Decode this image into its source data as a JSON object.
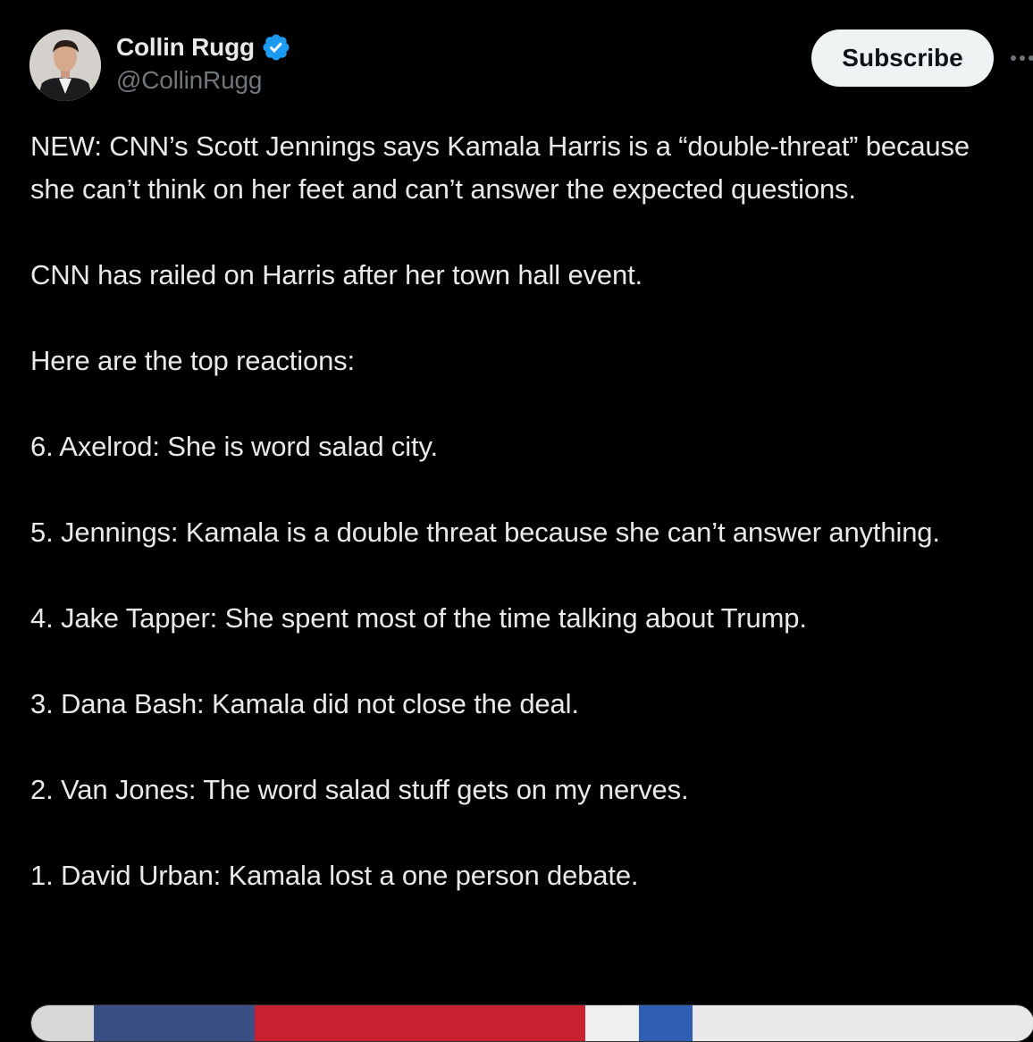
{
  "author": {
    "display_name": "Collin Rugg",
    "handle": "@CollinRugg",
    "verified": true,
    "verified_color": "#1d9bf0"
  },
  "actions": {
    "subscribe_label": "Subscribe",
    "more_icon": "more-horizontal-icon"
  },
  "tweet": {
    "paragraphs": [
      "NEW: CNN’s Scott Jennings says Kamala Harris is a “double-threat” because she can’t think on her feet and can’t answer the expected questions.",
      "CNN has railed on Harris after her town hall event.",
      "Here are the top reactions:",
      "6. Axelrod: She is word salad city.",
      "5. Jennings: Kamala is a double threat because she can’t answer anything.",
      "4. Jake Tapper: She spent most of the time talking about Trump.",
      "3. Dana Bash: Kamala did not close the deal.",
      "2. Van Jones: The word salad stuff gets on my nerves.",
      "1. David Urban: Kamala lost a one person debate."
    ]
  },
  "colors": {
    "background": "#000000",
    "text_primary": "#e7e9ea",
    "text_secondary": "#71767b",
    "button_bg": "#eff3f4",
    "button_text": "#0f1419"
  }
}
